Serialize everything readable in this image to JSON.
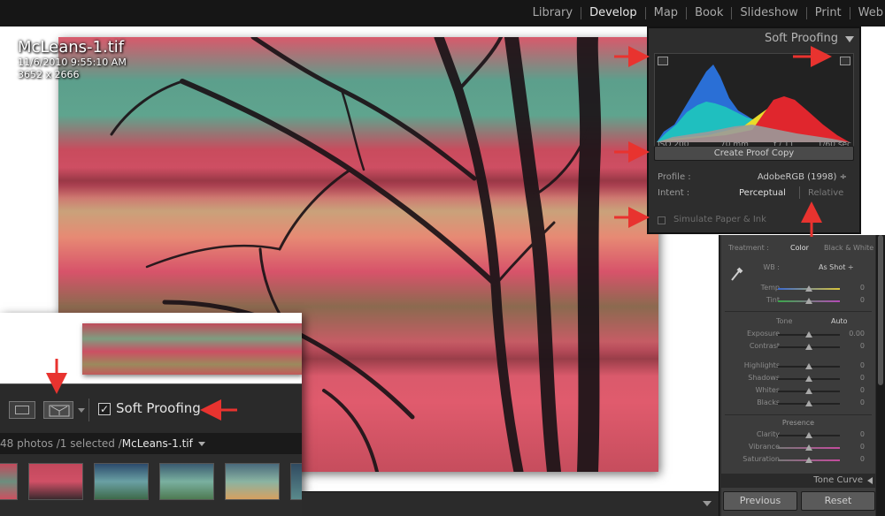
{
  "modules": [
    "Library",
    "Develop",
    "Map",
    "Book",
    "Slideshow",
    "Print",
    "Web"
  ],
  "active_module": "Develop",
  "photo_info": {
    "filename": "McLeans-1.tif",
    "datetime": "11/6/2010 9:55:10 AM",
    "dimensions": "3652 x 2666"
  },
  "soft_proofing_panel": {
    "title": "Soft Proofing",
    "histogram": {
      "iso": "ISO 200",
      "focal": "70 mm",
      "aperture": "ƒ / 11",
      "shutter": "1/60 sec"
    },
    "create_proof_copy_label": "Create Proof Copy",
    "profile_label": "Profile :",
    "profile_value": "AdobeRGB (1998) ÷",
    "intent_label": "Intent :",
    "intent_perceptual": "Perceptual",
    "intent_relative": "Relative",
    "simulate_label": "Simulate Paper & Ink"
  },
  "basic_panel": {
    "treatment_label": "Treatment :",
    "treatment_color": "Color",
    "treatment_bw": "Black & White",
    "wb_label": "WB :",
    "wb_value": "As Shot ÷",
    "temp_label": "Temp",
    "temp_value": "0",
    "tint_label": "Tint",
    "tint_value": "0",
    "tone_label": "Tone",
    "auto_label": "Auto",
    "exposure_label": "Exposure",
    "exposure_value": "0.00",
    "contrast_label": "Contrast",
    "contrast_value": "0",
    "highlights_label": "Highlights",
    "highlights_value": "0",
    "shadows_label": "Shadows",
    "shadows_value": "0",
    "whites_label": "Whites",
    "whites_value": "0",
    "blacks_label": "Blacks",
    "blacks_value": "0",
    "presence_label": "Presence",
    "clarity_label": "Clarity",
    "clarity_value": "0",
    "vibrance_label": "Vibrance",
    "vibrance_value": "0",
    "saturation_label": "Saturation",
    "saturation_value": "0",
    "tone_curve_label": "Tone Curve"
  },
  "buttons": {
    "previous": "Previous",
    "reset": "Reset"
  },
  "toolbar": {
    "soft_proofing_label": "Soft Proofing",
    "soft_proofing_checked": "✓"
  },
  "status": {
    "count": "48 photos /1 selected /",
    "filename": "McLeans-1.tif"
  },
  "colors": {
    "arrow": "#e8332f",
    "histogram_blue": "#2a6fd6",
    "histogram_cyan": "#1fbfbf",
    "histogram_yellow": "#e9dc2a",
    "histogram_red": "#e0262d",
    "panel_bg": "#2d2d2d"
  }
}
